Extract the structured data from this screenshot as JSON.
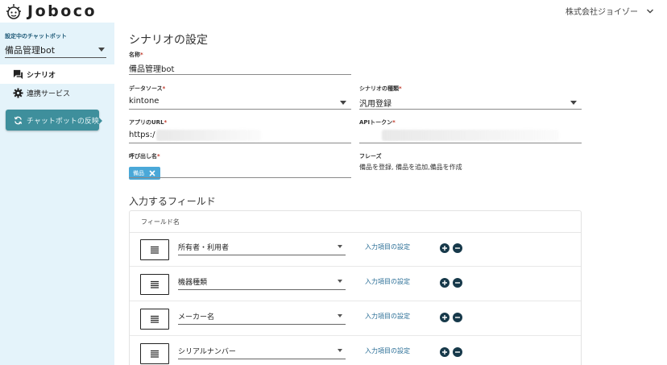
{
  "header": {
    "logo_text": "Joboco",
    "company": "株式会社ジョイゾー"
  },
  "sidebar": {
    "bot_label": "設定中のチャットボット",
    "bot_selected": "備品管理bot",
    "nav": [
      {
        "label": "シナリオ",
        "icon": "chat-icon",
        "active": true
      },
      {
        "label": "連携サービス",
        "icon": "gear-icon",
        "active": false
      }
    ],
    "reflect_button": "チャットボットの反映"
  },
  "main": {
    "title": "シナリオの設定",
    "name": {
      "label": "名称",
      "value": "備品管理bot"
    },
    "datasource": {
      "label": "データソース",
      "value": "kintone"
    },
    "scenario_type": {
      "label": "シナリオの種類",
      "value": "汎用登録"
    },
    "app_url": {
      "label": "アプリのURL",
      "value": "https:/"
    },
    "api_token": {
      "label": "APIトークン",
      "value": ""
    },
    "invoke_name": {
      "label": "呼び出し名",
      "chips": [
        "備品"
      ]
    },
    "phrases": {
      "label": "フレーズ",
      "value": "備品を登録, 備品を追加,備品を作成"
    },
    "required_mark": "*",
    "input_fields": {
      "title": "入力するフィールド",
      "column_header": "フィールド名",
      "rows": [
        {
          "field": "所有者・利用者",
          "link": "入力項目の設定"
        },
        {
          "field": "機器種類",
          "link": "入力項目の設定"
        },
        {
          "field": "メーカー名",
          "link": "入力項目の設定"
        },
        {
          "field": "シリアルナンバー",
          "link": "入力項目の設定"
        }
      ]
    }
  },
  "colors": {
    "sidebar_bg": "#e4f3fa",
    "accent_teal": "#3e8f9c",
    "chip_blue": "#4aa8d8",
    "link_blue": "#2a6e96",
    "round_button": "#17394a"
  }
}
